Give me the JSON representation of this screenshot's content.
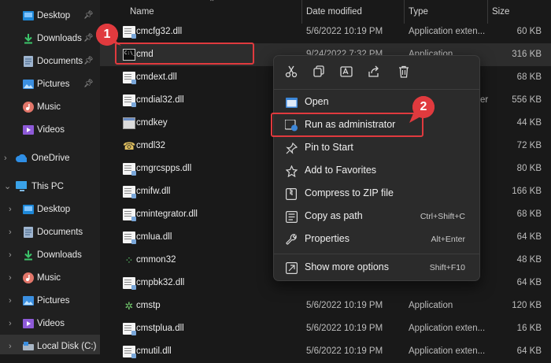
{
  "sidebar": {
    "quick_access": [
      {
        "label": "Desktop",
        "icon": "desktop-folder-icon",
        "pinned": true
      },
      {
        "label": "Downloads",
        "icon": "downloads-folder-icon",
        "pinned": true
      },
      {
        "label": "Documents",
        "icon": "documents-folder-icon",
        "pinned": true
      },
      {
        "label": "Pictures",
        "icon": "pictures-folder-icon",
        "pinned": true
      },
      {
        "label": "Music",
        "icon": "music-folder-icon",
        "pinned": false
      },
      {
        "label": "Videos",
        "icon": "videos-folder-icon",
        "pinned": false
      }
    ],
    "onedrive": {
      "label": "OneDrive",
      "icon": "cloud-icon"
    },
    "this_pc": {
      "label": "This PC",
      "icon": "monitor-icon"
    },
    "pc_items": [
      {
        "label": "Desktop",
        "icon": "desktop-folder-icon"
      },
      {
        "label": "Documents",
        "icon": "documents-folder-icon"
      },
      {
        "label": "Downloads",
        "icon": "downloads-folder-icon"
      },
      {
        "label": "Music",
        "icon": "music-folder-icon"
      },
      {
        "label": "Pictures",
        "icon": "pictures-folder-icon"
      },
      {
        "label": "Videos",
        "icon": "videos-folder-icon"
      },
      {
        "label": "Local Disk (C:)",
        "icon": "drive-icon"
      }
    ]
  },
  "columns": {
    "name": "Name",
    "date": "Date modified",
    "type": "Type",
    "size": "Size"
  },
  "files": [
    {
      "name": "cmcfg32.dll",
      "date": "5/6/2022 10:19 PM",
      "type": "Application exten...",
      "size": "60 KB",
      "icon": "dll"
    },
    {
      "name": "cmd",
      "date": "9/24/2022 7:32 PM",
      "type": "Application",
      "size": "316 KB",
      "icon": "cmd",
      "selected": true
    },
    {
      "name": "cmdext.dll",
      "date": "",
      "type": "",
      "size": "68 KB",
      "icon": "dll"
    },
    {
      "name": "cmdial32.dll",
      "date": "",
      "type": "er",
      "size": "556 KB",
      "icon": "dll"
    },
    {
      "name": "cmdkey",
      "date": "",
      "type": "",
      "size": "44 KB",
      "icon": "exe"
    },
    {
      "name": "cmdl32",
      "date": "",
      "type": "",
      "size": "72 KB",
      "icon": "cmdl32"
    },
    {
      "name": "cmgrcspps.dll",
      "date": "",
      "type": "",
      "size": "80 KB",
      "icon": "dll"
    },
    {
      "name": "cmifw.dll",
      "date": "",
      "type": "",
      "size": "166 KB",
      "icon": "dll"
    },
    {
      "name": "cmintegrator.dll",
      "date": "",
      "type": "",
      "size": "68 KB",
      "icon": "dll"
    },
    {
      "name": "cmlua.dll",
      "date": "",
      "type": "",
      "size": "64 KB",
      "icon": "dll"
    },
    {
      "name": "cmmon32",
      "date": "",
      "type": "",
      "size": "48 KB",
      "icon": "cmmon32"
    },
    {
      "name": "cmpbk32.dll",
      "date": "",
      "type": "",
      "size": "64 KB",
      "icon": "dll"
    },
    {
      "name": "cmstp",
      "date": "5/6/2022 10:19 PM",
      "type": "Application",
      "size": "120 KB",
      "icon": "cmstp"
    },
    {
      "name": "cmstplua.dll",
      "date": "5/6/2022 10:19 PM",
      "type": "Application exten...",
      "size": "16 KB",
      "icon": "dll"
    },
    {
      "name": "cmutil.dll",
      "date": "5/6/2022 10:19 PM",
      "type": "Application exten...",
      "size": "64 KB",
      "icon": "dll"
    }
  ],
  "context_menu": {
    "toolbar": [
      {
        "name": "cut-icon",
        "glyph": "✂"
      },
      {
        "name": "copy-icon",
        "glyph": "❐"
      },
      {
        "name": "rename-icon",
        "glyph": "A"
      },
      {
        "name": "share-icon",
        "glyph": "⇪"
      },
      {
        "name": "delete-icon",
        "glyph": "🗑"
      }
    ],
    "items": [
      {
        "label": "Open",
        "shortcut": "",
        "icon": "open-window-icon"
      },
      {
        "label": "Run as administrator",
        "shortcut": "",
        "icon": "admin-shield-icon"
      },
      {
        "label": "Pin to Start",
        "shortcut": "",
        "icon": "pin-icon"
      },
      {
        "label": "Add to Favorites",
        "shortcut": "",
        "icon": "star-icon"
      },
      {
        "label": "Compress to ZIP file",
        "shortcut": "",
        "icon": "zip-icon"
      },
      {
        "label": "Copy as path",
        "shortcut": "Ctrl+Shift+C",
        "icon": "copy-path-icon"
      },
      {
        "label": "Properties",
        "shortcut": "Alt+Enter",
        "icon": "wrench-icon"
      },
      {
        "label": "Show more options",
        "shortcut": "Shift+F10",
        "icon": "more-options-icon"
      }
    ]
  },
  "annotations": {
    "step1": "1",
    "step2": "2"
  },
  "colors": {
    "accent_red": "#e03a3e",
    "background": "#191919",
    "menu": "#2b2b2b"
  }
}
